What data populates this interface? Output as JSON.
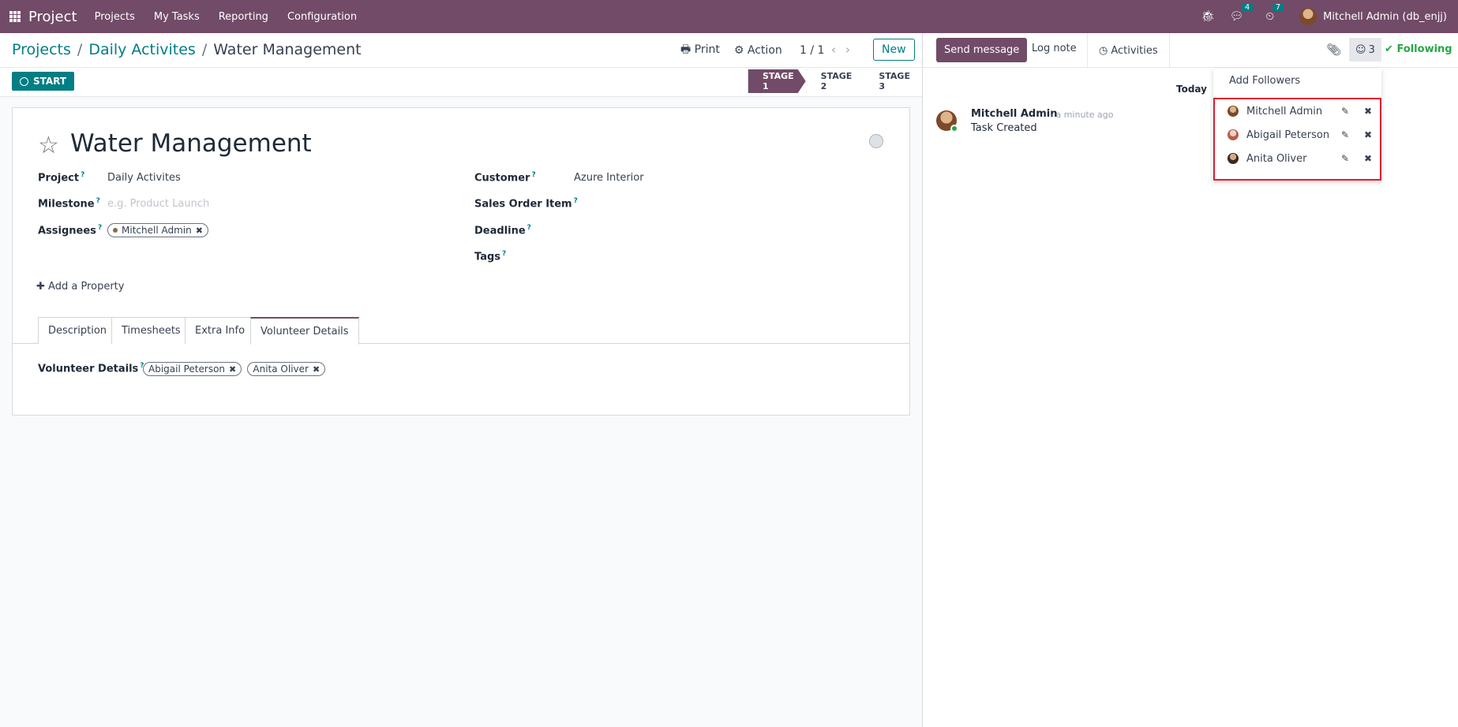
{
  "navbar": {
    "app_name": "Project",
    "menu": [
      "Projects",
      "My Tasks",
      "Reporting",
      "Configuration"
    ],
    "messages_count": "4",
    "activities_count": "7",
    "user": "Mitchell Admin (db_enjj)"
  },
  "breadcrumb": {
    "items": [
      "Projects",
      "Daily Activites"
    ],
    "current": "Water Management"
  },
  "control_panel": {
    "print_label": "Print",
    "action_label": "Action",
    "pager": "1 / 1",
    "new_label": "New"
  },
  "status_bar": {
    "start_label": "START",
    "stages": [
      "STAGE 1",
      "STAGE 2",
      "STAGE 3"
    ],
    "active_stage": "STAGE 1"
  },
  "task": {
    "title": "Water Management",
    "fields": {
      "project_label": "Project",
      "project_value": "Daily Activites",
      "milestone_label": "Milestone",
      "milestone_placeholder": "e.g. Product Launch",
      "assignees_label": "Assignees",
      "assignee": "Mitchell Admin",
      "customer_label": "Customer",
      "customer_value": "Azure Interior",
      "sales_order_label": "Sales Order Item",
      "deadline_label": "Deadline",
      "tags_label": "Tags",
      "help_marker": "?"
    },
    "add_property": "Add a Property",
    "tabs": [
      "Description",
      "Timesheets",
      "Extra Info",
      "Volunteer Details"
    ],
    "active_tab": "Volunteer Details",
    "volunteer_label": "Volunteer Details",
    "volunteers": [
      "Abigail Peterson",
      "Anita Oliver"
    ]
  },
  "chatter": {
    "send_message": "Send message",
    "log_note": "Log note",
    "activities": "Activities",
    "followers_count": "3",
    "following": "Following",
    "today": "Today",
    "message": {
      "author": "Mitchell Admin",
      "time": "- a minute ago",
      "body": "Task Created"
    }
  },
  "followers_dropdown": {
    "add_followers": "Add Followers",
    "followers": [
      "Mitchell Admin",
      "Abigail Peterson",
      "Anita Oliver"
    ]
  },
  "colors": {
    "brand": "#714B67",
    "accent": "#017e84",
    "following": "#28a745",
    "highlight_border": "#e11d2e"
  }
}
